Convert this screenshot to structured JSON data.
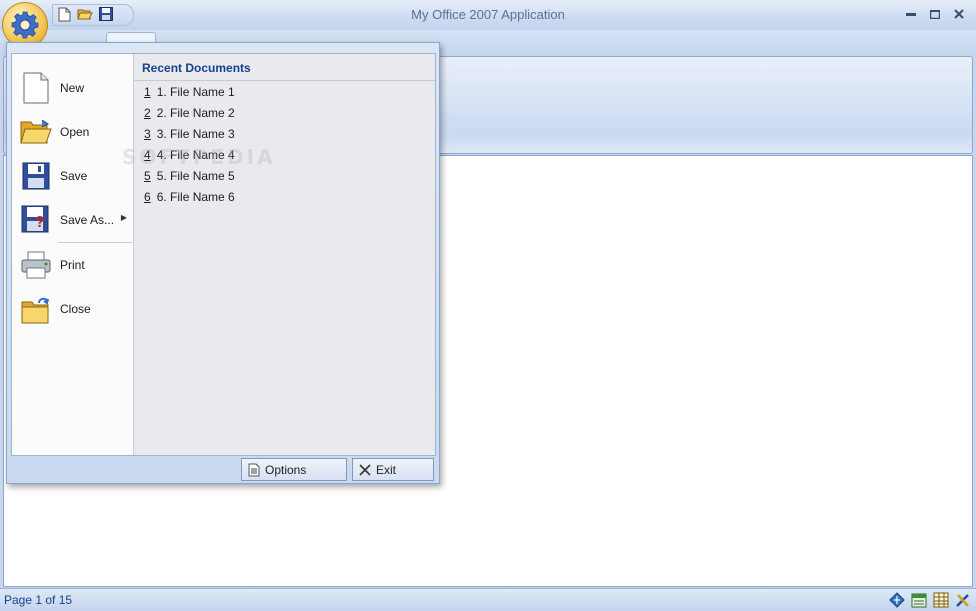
{
  "window": {
    "title": "My Office 2007 Application",
    "minimize_glyph": "▬",
    "maximize_glyph": "▢",
    "close_glyph": "✕"
  },
  "qat": {
    "icons": [
      "new-document-icon",
      "open-folder-icon",
      "save-disk-icon"
    ]
  },
  "app_menu": {
    "commands": [
      {
        "label": "New",
        "icon": "new-document-icon"
      },
      {
        "label": "Open",
        "icon": "open-folder-icon"
      },
      {
        "label": "Save",
        "icon": "save-disk-icon"
      },
      {
        "label": "Save As...",
        "icon": "save-as-icon",
        "has_submenu": true
      },
      {
        "label": "Print",
        "icon": "printer-icon"
      },
      {
        "label": "Close",
        "icon": "close-folder-icon"
      }
    ],
    "recent": {
      "title": "Recent Documents",
      "items": [
        {
          "num": "1",
          "name": "1. File Name 1"
        },
        {
          "num": "2",
          "name": "2. File Name 2"
        },
        {
          "num": "3",
          "name": "3. File Name 3"
        },
        {
          "num": "4",
          "name": "4. File Name 4"
        },
        {
          "num": "5",
          "name": "5. File Name 5"
        },
        {
          "num": "6",
          "name": "6. File Name 6"
        }
      ]
    },
    "footer": {
      "options_label": "Options",
      "exit_label": "Exit"
    }
  },
  "statusbar": {
    "page_text": "Page 1 of 15",
    "icons": [
      "navigate-icon",
      "calendar-icon",
      "table-icon",
      "tools-icon"
    ]
  },
  "watermark": "SOFTPEDIA",
  "colors": {
    "accent": "#15428b",
    "frame": "#c7d6ec"
  }
}
